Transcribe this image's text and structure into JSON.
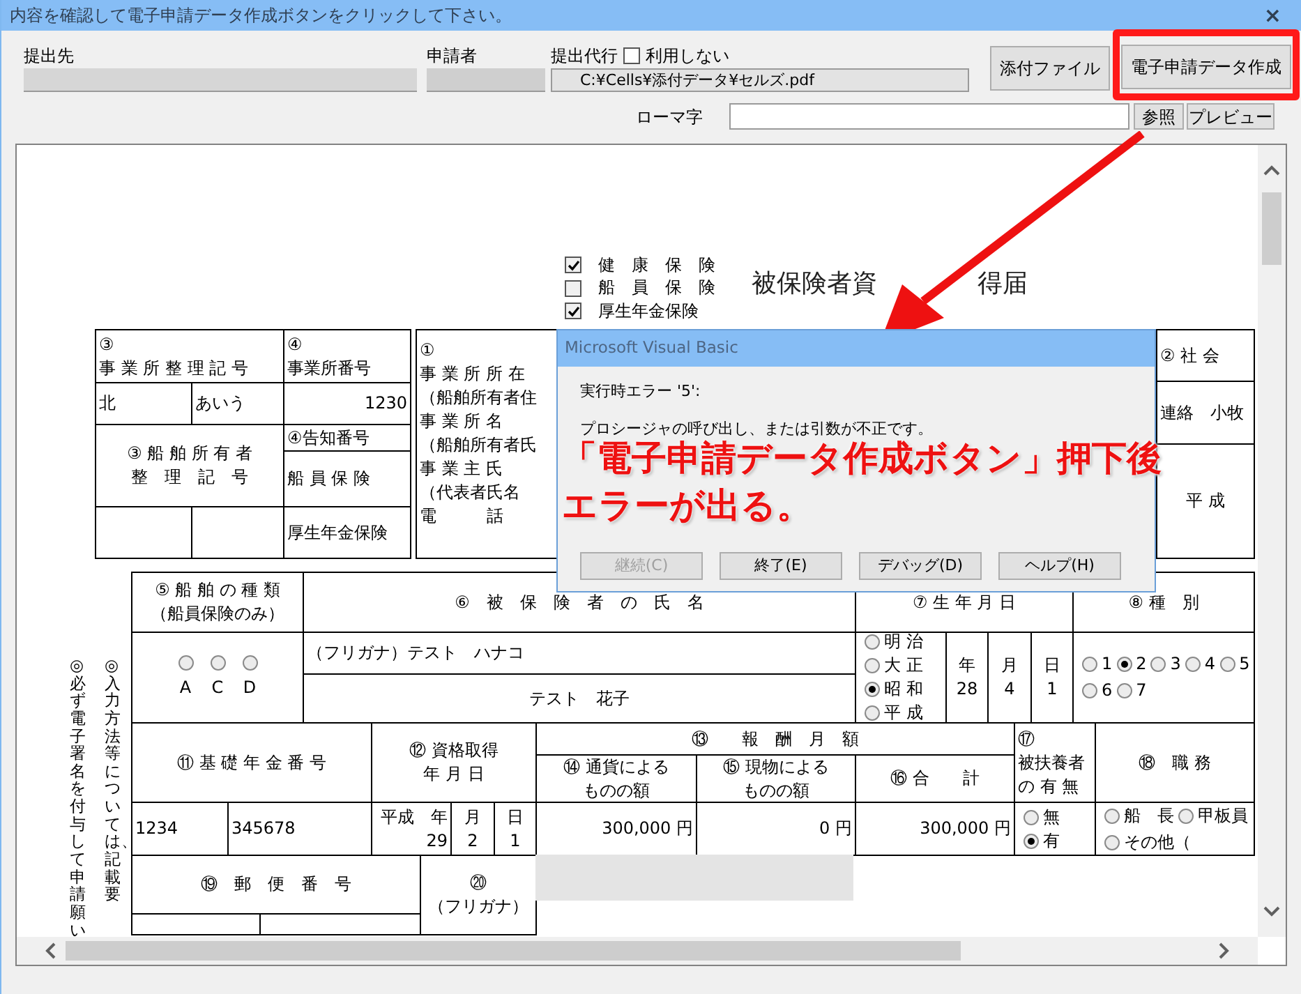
{
  "window": {
    "title": "内容を確認して電子申請データ作成ボタンをクリックして下さい。",
    "close": "×"
  },
  "header": {
    "destination_label": "提出先",
    "applicant_label": "申請者",
    "proxy_label": "提出代行",
    "proxy_option": {
      "label": "利用しない",
      "checked": false
    },
    "attachment_path": "C:¥Cells¥添付データ¥セルズ.pdf",
    "romaji_label": "ローマ字",
    "buttons": [
      {
        "label": "添付ファイル",
        "highlighted": false
      },
      {
        "label": "電子申請データ作成",
        "highlighted": true
      }
    ],
    "browse_button": "参照",
    "preview_button": "プレビュー"
  },
  "form": {
    "insurance_checks": [
      {
        "label": "健　康　保　険",
        "checked": true
      },
      {
        "label": "船　員　保　険",
        "checked": false
      },
      {
        "label": "厚生年金保険",
        "checked": true
      }
    ],
    "title_parts": [
      "被保険者資",
      "得届"
    ],
    "notes": [
      "◎必ず電子署名を付与して申請願い",
      "◎入力方法等については、記載要"
    ],
    "cells": [
      {
        "kind": "text",
        "texts": [
          "③",
          "事 業 所 整 理 記 号"
        ]
      },
      {
        "kind": "text",
        "texts": [
          "④",
          "事業所番号"
        ]
      },
      {
        "kind": "text",
        "texts": [
          "北"
        ]
      },
      {
        "kind": "text",
        "texts": [
          "あいう"
        ]
      },
      {
        "kind": "text",
        "texts": [
          "1230"
        ]
      },
      {
        "kind": "text",
        "texts": [
          "③ 船 舶 所 有 者",
          "整　理　記　号"
        ]
      },
      {
        "kind": "text",
        "texts": [
          "④告知番号"
        ]
      },
      {
        "kind": "text",
        "texts": [
          "船 員 保 険"
        ]
      },
      {
        "kind": "text"
      },
      {
        "kind": "text"
      },
      {
        "kind": "text",
        "texts": [
          "厚生年金保険"
        ]
      },
      {
        "kind": "text",
        "texts": [
          "①",
          "事 業 所 所 在",
          "（船舶所有者住",
          "事 業 所 名",
          "（船舶所有者氏",
          "事 業 主 氏",
          "（代表者氏名",
          "電　　　話"
        ]
      },
      {
        "kind": "text",
        "texts": [
          "② 社 会"
        ]
      },
      {
        "kind": "text",
        "texts": [
          "連絡　小牧"
        ]
      },
      {
        "kind": "text",
        "texts": [
          "平 成"
        ]
      },
      {
        "kind": "text",
        "texts": [
          "⑤ 船 舶 の 種 類",
          "（船員保険のみ）"
        ]
      },
      {
        "kind": "text",
        "texts": [
          "⑥　被　保　険　者　の　氏　名"
        ]
      },
      {
        "kind": "text",
        "texts": [
          "⑦ 生 年 月 日"
        ]
      },
      {
        "kind": "text",
        "texts": [
          "⑧ 種　別"
        ]
      },
      {
        "kind": "radios",
        "options": [
          {
            "label": "A",
            "selected": false
          },
          {
            "label": "C",
            "selected": false
          },
          {
            "label": "D",
            "selected": false
          }
        ]
      },
      {
        "kind": "text",
        "texts": [
          "（フリガナ）テスト　ハナコ"
        ]
      },
      {
        "kind": "text",
        "texts": [
          "テスト　花子"
        ]
      },
      {
        "kind": "radios",
        "options": [
          {
            "label": "明 治",
            "selected": false
          },
          {
            "label": "大 正",
            "selected": false
          },
          {
            "label": "昭 和",
            "selected": true
          },
          {
            "label": "平 成",
            "selected": false
          }
        ]
      },
      {
        "kind": "text",
        "texts": [
          "年",
          "28"
        ]
      },
      {
        "kind": "text",
        "texts": [
          "月",
          "4"
        ]
      },
      {
        "kind": "text",
        "texts": [
          "日",
          "1"
        ]
      },
      {
        "kind": "radios",
        "options": [
          {
            "label": "1",
            "selected": false
          },
          {
            "label": "2",
            "selected": true
          },
          {
            "label": "3",
            "selected": false
          },
          {
            "label": "4",
            "selected": false
          },
          {
            "label": "5",
            "selected": false
          },
          {
            "label": "6",
            "selected": false
          },
          {
            "label": "7",
            "selected": false
          }
        ]
      },
      {
        "kind": "text",
        "texts": [
          "⑪ 基 礎 年 金 番 号"
        ]
      },
      {
        "kind": "text",
        "texts": [
          "⑫ 資格取得",
          "年 月 日"
        ]
      },
      {
        "kind": "text",
        "texts": [
          "⑬　　報　酬　月　額"
        ]
      },
      {
        "kind": "text",
        "texts": [
          "⑭ 通貨による",
          "ものの額"
        ]
      },
      {
        "kind": "text",
        "texts": [
          "⑮ 現物による",
          "ものの額"
        ]
      },
      {
        "kind": "text",
        "texts": [
          "⑯ 合　　計"
        ]
      },
      {
        "kind": "text",
        "texts": [
          "⑰",
          "被扶養者",
          "の 有 無"
        ]
      },
      {
        "kind": "text",
        "texts": [
          "⑱　職 務"
        ]
      },
      {
        "kind": "text",
        "texts": [
          "1234"
        ]
      },
      {
        "kind": "text",
        "texts": [
          "345678"
        ]
      },
      {
        "kind": "text",
        "texts": [
          "平成　年",
          "29"
        ]
      },
      {
        "kind": "text",
        "texts": [
          "月",
          "2"
        ]
      },
      {
        "kind": "text",
        "texts": [
          "日",
          "1"
        ]
      },
      {
        "kind": "text",
        "texts": [
          "300,000 円"
        ]
      },
      {
        "kind": "text",
        "texts": [
          "0 円"
        ]
      },
      {
        "kind": "text",
        "texts": [
          "300,000 円"
        ]
      },
      {
        "kind": "radios",
        "options": [
          {
            "label": "無",
            "selected": false
          },
          {
            "label": "有",
            "selected": true
          }
        ]
      },
      {
        "kind": "radios",
        "options": [
          {
            "label": "船　長",
            "selected": false
          },
          {
            "label": "甲板員",
            "selected": false
          },
          {
            "label": "その他（",
            "selected": false
          }
        ]
      },
      {
        "kind": "text",
        "texts": [
          "⑲　郵　便　番　号"
        ]
      },
      {
        "kind": "text",
        "texts": [
          "⑳",
          "（フリガナ）"
        ]
      },
      {
        "kind": "text"
      },
      {
        "kind": "text"
      }
    ]
  },
  "dialog": {
    "title": "Microsoft Visual Basic",
    "error": "実行時エラー '5':",
    "message": "プロシージャの呼び出し、または引数が不正です。",
    "buttons": [
      {
        "label": "継続(C)",
        "disabled": true
      },
      {
        "label": "終了(E)",
        "disabled": false
      },
      {
        "label": "デバッグ(D)",
        "disabled": false
      },
      {
        "label": "ヘルプ(H)",
        "disabled": false
      }
    ]
  },
  "annotation": [
    "「電子申請データ作成ボタン」押下後",
    "エラーが出る。"
  ]
}
